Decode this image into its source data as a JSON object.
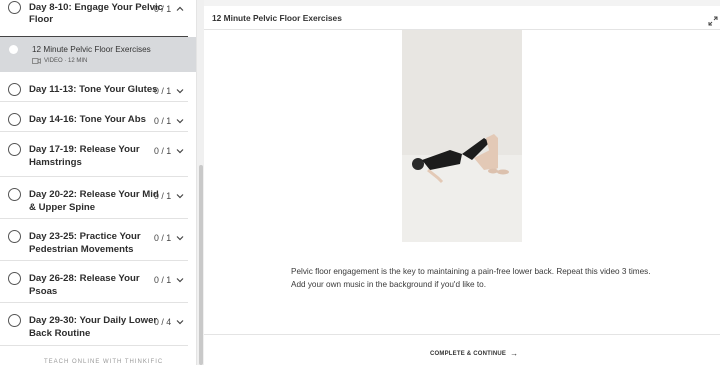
{
  "sidebar": {
    "active_section": {
      "title_line1": "Day 8-10: Engage Your Pelvic",
      "title_line2": "Floor",
      "count": "0 / 1"
    },
    "active_lesson": {
      "title": "12 Minute Pelvic Floor Exercises",
      "meta": "VIDEO · 12 MIN"
    },
    "sections": [
      {
        "line1": "Day 11-13: Tone Your Glutes",
        "line2": "",
        "count": "0 / 1"
      },
      {
        "line1": "Day 14-16: Tone Your Abs",
        "line2": "",
        "count": "0 / 1"
      },
      {
        "line1": "Day 17-19: Release Your",
        "line2": "Hamstrings",
        "count": "0 / 1"
      },
      {
        "line1": "Day 20-22: Release Your Mid",
        "line2": "& Upper Spine",
        "count": "0 / 1"
      },
      {
        "line1": "Day 23-25: Practice Your",
        "line2": "Pedestrian Movements",
        "count": "0 / 1"
      },
      {
        "line1": "Day 26-28: Release Your",
        "line2": "Psoas",
        "count": "0 / 1"
      },
      {
        "line1": "Day 29-30: Your Daily Lower",
        "line2": "Back Routine",
        "count": "0 / 4"
      }
    ],
    "footer": "TEACH ONLINE WITH THINKIFIC"
  },
  "main": {
    "header_title": "12 Minute Pelvic Floor Exercises",
    "description_line1": "Pelvic floor engagement is the key to maintaining a pain-free lower back. Repeat this video 3 times.",
    "description_line2": "Add your own music in the background if you'd like to.",
    "complete_label": "COMPLETE & CONTINUE",
    "complete_arrow": "→"
  },
  "icons": {
    "chevron": "chevron-down-icon",
    "chevron_up": "chevron-up-icon",
    "expand": "expand-icon",
    "video": "video-icon"
  }
}
